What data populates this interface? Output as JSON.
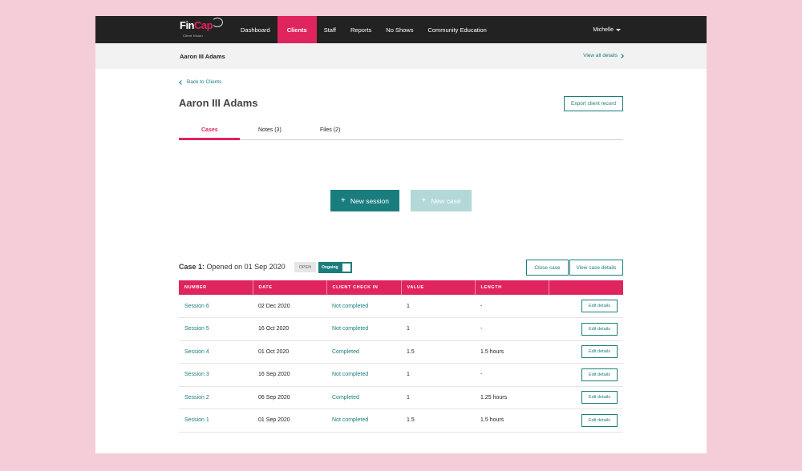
{
  "brand": {
    "name_part1": "Fin",
    "name_part2": "Cap",
    "subtitle": "Client Vision",
    "accent": "#e0245e",
    "teal": "#1a7d7d"
  },
  "nav": {
    "items": [
      {
        "label": "Dashboard"
      },
      {
        "label": "Clients"
      },
      {
        "label": "Staff"
      },
      {
        "label": "Reports"
      },
      {
        "label": "No Shows"
      },
      {
        "label": "Community Education"
      }
    ],
    "active": "Clients",
    "user": "Michelle"
  },
  "subbar": {
    "client_name": "Aaron III Adams",
    "view_all": "View all details"
  },
  "page": {
    "back_label": "Back to Clients",
    "title": "Aaron III Adams",
    "export_label": "Export client record",
    "tabs": [
      {
        "label": "Cases"
      },
      {
        "label": "Notes (3)"
      },
      {
        "label": "Files (2)"
      }
    ],
    "active_tab": "Cases",
    "new_session_label": "New session",
    "new_case_label": "New case"
  },
  "case": {
    "number_label": "Case 1:",
    "opened_text": "Opened on 01 Sep 2020",
    "status_badge": "OPEN",
    "toggle_label": "Ongoing",
    "close_label": "Close case",
    "view_label": "View case details",
    "columns": [
      "NUMBER",
      "DATE",
      "CLIENT CHECK IN",
      "VALUE",
      "LENGTH",
      ""
    ],
    "rows": [
      {
        "number": "Session 6",
        "date": "02 Dec 2020",
        "checkin": "Not completed",
        "value": "1",
        "length": "-",
        "action": "Edit details"
      },
      {
        "number": "Session 5",
        "date": "16 Oct 2020",
        "checkin": "Not completed",
        "value": "1",
        "length": "-",
        "action": "Edit details"
      },
      {
        "number": "Session 4",
        "date": "01 Oct 2020",
        "checkin": "Completed",
        "value": "1.5",
        "length": "1.5 hours",
        "action": "Edit details"
      },
      {
        "number": "Session 3",
        "date": "16 Sep 2020",
        "checkin": "Not completed",
        "value": "1",
        "length": "-",
        "action": "Edit details"
      },
      {
        "number": "Session 2",
        "date": "06 Sep 2020",
        "checkin": "Completed",
        "value": "1",
        "length": "1.25 hours",
        "action": "Edit details"
      },
      {
        "number": "Session 1",
        "date": "01 Sep 2020",
        "checkin": "Not completed",
        "value": "1.5",
        "length": "1.5 hours",
        "action": "Edit details"
      }
    ]
  }
}
